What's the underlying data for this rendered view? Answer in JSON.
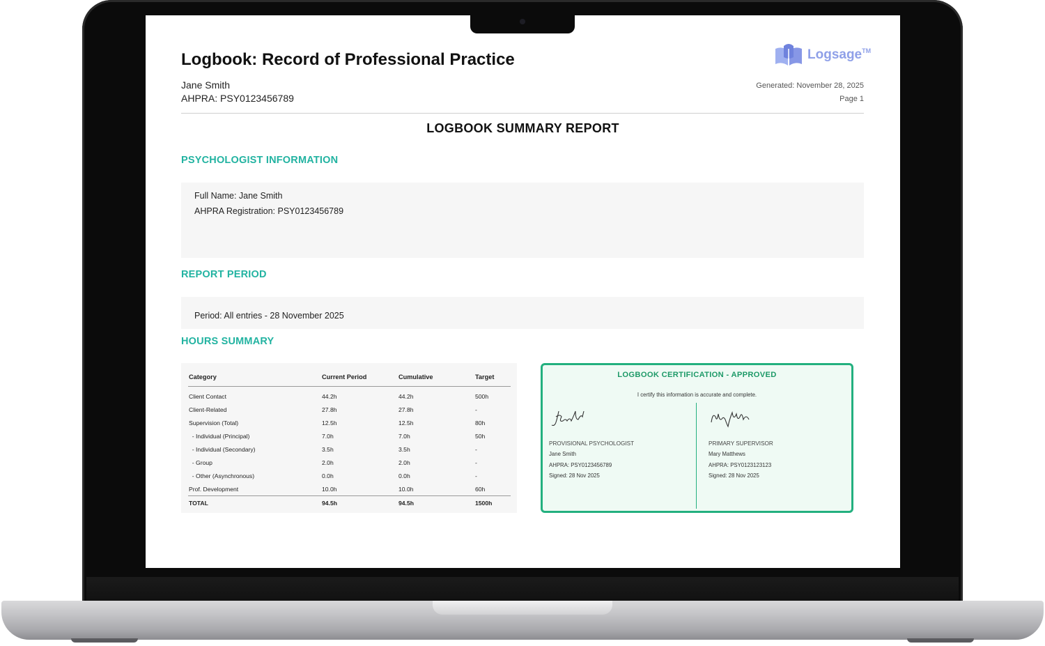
{
  "document": {
    "title": "Logbook: Record of Professional Practice",
    "name": "Jane Smith",
    "ahpra": "AHPRA: PSY0123456789",
    "generated": "Generated: November 28, 2025",
    "page": "Page 1",
    "logo_text": "Logsage",
    "logo_tm": "TM",
    "report_title": "LOGBOOK SUMMARY REPORT"
  },
  "psychologist_info": {
    "heading": "PSYCHOLOGIST INFORMATION",
    "full_name": "Full Name: Jane Smith",
    "registration": "AHPRA Registration: PSY0123456789"
  },
  "report_period": {
    "heading": "REPORT PERIOD",
    "period": "Period: All entries - 28 November 2025"
  },
  "hours_summary": {
    "heading": "HOURS SUMMARY",
    "columns": [
      "Category",
      "Current Period",
      "Cumulative",
      "Target"
    ],
    "rows": [
      [
        "Client Contact",
        "44.2h",
        "44.2h",
        "500h"
      ],
      [
        "Client-Related",
        "27.8h",
        "27.8h",
        "-"
      ],
      [
        "Supervision (Total)",
        "12.5h",
        "12.5h",
        "80h"
      ],
      [
        "  - Individual (Principal)",
        "7.0h",
        "7.0h",
        "50h"
      ],
      [
        "  - Individual (Secondary)",
        "3.5h",
        "3.5h",
        "-"
      ],
      [
        "  - Group",
        "2.0h",
        "2.0h",
        "-"
      ],
      [
        "  - Other (Asynchronous)",
        "0.0h",
        "0.0h",
        "-"
      ],
      [
        "Prof. Development",
        "10.0h",
        "10.0h",
        "60h"
      ]
    ],
    "total": [
      "TOTAL",
      "94.5h",
      "94.5h",
      "1500h"
    ]
  },
  "certification": {
    "title": "LOGBOOK CERTIFICATION - APPROVED",
    "statement": "I certify this information is accurate and complete.",
    "left": {
      "role": "PROVISIONAL PSYCHOLOGIST",
      "name": "Jane Smith",
      "ahpra": "AHPRA: PSY0123456789",
      "signed": "Signed: 28 Nov 2025"
    },
    "right": {
      "role": "PRIMARY SUPERVISOR",
      "name": "Mary Matthews",
      "ahpra": "AHPRA: PSY0123123123",
      "signed": "Signed: 28 Nov 2025"
    }
  },
  "colors": {
    "section_heading": "#22b3a1",
    "cert_border": "#23b07f",
    "logo": "#8fa0e8"
  },
  "icons": [
    "logsage-book-logo-icon",
    "signature-icon"
  ]
}
